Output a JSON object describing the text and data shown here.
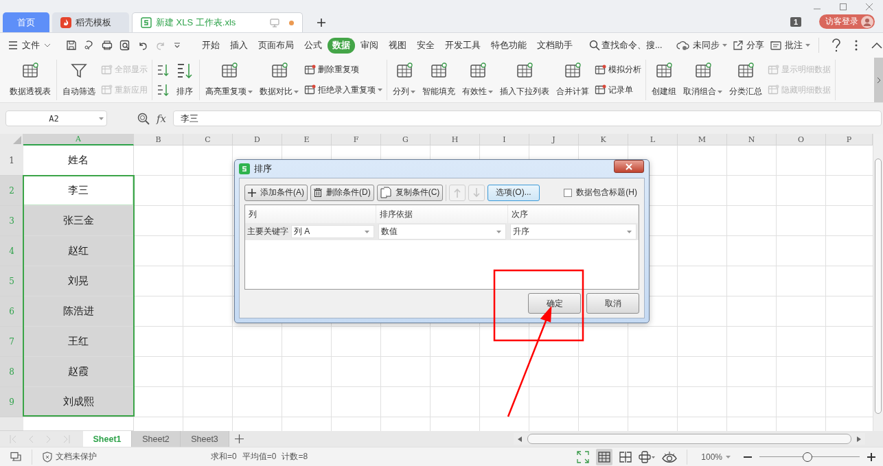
{
  "window": {
    "tabs": [
      {
        "label": "首页",
        "kind": "home",
        "selected": false
      },
      {
        "label": "稻壳模板",
        "kind": "docer",
        "selected": false
      },
      {
        "label": "新建 XLS 工作表.xls",
        "kind": "sheet",
        "selected": true
      }
    ],
    "badge": "1",
    "login": "访客登录"
  },
  "menu": {
    "file": "文件",
    "tabs": [
      {
        "label": "开始",
        "selected": false
      },
      {
        "label": "插入",
        "selected": false
      },
      {
        "label": "页面布局",
        "selected": false
      },
      {
        "label": "公式",
        "selected": false
      },
      {
        "label": "数据",
        "selected": true
      },
      {
        "label": "审阅",
        "selected": false
      },
      {
        "label": "视图",
        "selected": false
      },
      {
        "label": "安全",
        "selected": false
      },
      {
        "label": "开发工具",
        "selected": false
      },
      {
        "label": "特色功能",
        "selected": false
      },
      {
        "label": "文档助手",
        "selected": false
      }
    ],
    "search": "查找命令、搜...",
    "actions": [
      {
        "label": "未同步",
        "dropdown": true
      },
      {
        "label": "分享",
        "dropdown": false
      },
      {
        "label": "批注",
        "dropdown": true
      }
    ]
  },
  "ribbon": {
    "groups": [
      {
        "items": [
          {
            "kind": "large",
            "label": "数据透视表",
            "dropdown": false
          }
        ]
      },
      {
        "items": [
          {
            "kind": "large",
            "label": "自动筛选",
            "dropdown": false
          },
          {
            "kind": "column",
            "items": [
              {
                "label": "全部显示",
                "disabled": true,
                "dropdown": false
              },
              {
                "label": "重新应用",
                "disabled": true,
                "dropdown": false
              }
            ]
          }
        ]
      },
      {
        "items": [
          {
            "kind": "sort_icons"
          },
          {
            "kind": "large",
            "label": "排序",
            "dropdown": false
          }
        ]
      },
      {
        "items": [
          {
            "kind": "large",
            "label": "高亮重复项",
            "dropdown": true
          },
          {
            "kind": "large",
            "label": "数据对比",
            "dropdown": true
          },
          {
            "kind": "column",
            "items": [
              {
                "label": "删除重复项",
                "disabled": false,
                "dropdown": false
              },
              {
                "label": "拒绝录入重复项",
                "disabled": false,
                "dropdown": true
              }
            ]
          }
        ]
      },
      {
        "items": [
          {
            "kind": "large",
            "label": "分列",
            "dropdown": true
          },
          {
            "kind": "large",
            "label": "智能填充",
            "dropdown": false
          },
          {
            "kind": "large",
            "label": "有效性",
            "dropdown": true
          },
          {
            "kind": "large",
            "label": "插入下拉列表",
            "dropdown": false
          },
          {
            "kind": "large",
            "label": "合并计算",
            "dropdown": false
          },
          {
            "kind": "column",
            "items": [
              {
                "label": "模拟分析",
                "disabled": false,
                "dropdown": false
              },
              {
                "label": "记录单",
                "disabled": false,
                "dropdown": false
              }
            ]
          }
        ]
      },
      {
        "items": [
          {
            "kind": "large",
            "label": "创建组",
            "dropdown": false
          },
          {
            "kind": "large",
            "label": "取消组合",
            "dropdown": true
          },
          {
            "kind": "large",
            "label": "分类汇总",
            "dropdown": false
          },
          {
            "kind": "column",
            "items": [
              {
                "label": "显示明细数据",
                "disabled": true,
                "dropdown": false
              },
              {
                "label": "隐藏明细数据",
                "disabled": true,
                "dropdown": false
              }
            ]
          }
        ]
      }
    ]
  },
  "formula_bar": {
    "cell": "A2",
    "fx": "fx",
    "value": "李三"
  },
  "grid": {
    "columns": [
      {
        "label": "A",
        "selected": true
      },
      {
        "label": "B",
        "selected": false
      },
      {
        "label": "C",
        "selected": false
      },
      {
        "label": "D",
        "selected": false
      },
      {
        "label": "E",
        "selected": false
      },
      {
        "label": "F",
        "selected": false
      },
      {
        "label": "G",
        "selected": false
      },
      {
        "label": "H",
        "selected": false
      },
      {
        "label": "I",
        "selected": false
      },
      {
        "label": "J",
        "selected": false
      },
      {
        "label": "K",
        "selected": false
      },
      {
        "label": "L",
        "selected": false
      },
      {
        "label": "M",
        "selected": false
      },
      {
        "label": "N",
        "selected": false
      },
      {
        "label": "O",
        "selected": false
      },
      {
        "label": "P",
        "selected": false
      }
    ],
    "rows": [
      {
        "number": "1",
        "value": "姓名",
        "selected": false,
        "active": false
      },
      {
        "number": "2",
        "value": "李三",
        "selected": true,
        "active": true
      },
      {
        "number": "3",
        "value": "张三金",
        "selected": true,
        "active": false
      },
      {
        "number": "4",
        "value": "赵红",
        "selected": true,
        "active": false
      },
      {
        "number": "5",
        "value": "刘晃",
        "selected": true,
        "active": false
      },
      {
        "number": "6",
        "value": "陈浩进",
        "selected": true,
        "active": false
      },
      {
        "number": "7",
        "value": "王红",
        "selected": true,
        "active": false
      },
      {
        "number": "8",
        "value": "赵霞",
        "selected": true,
        "active": false
      },
      {
        "number": "9",
        "value": "刘成熙",
        "selected": true,
        "active": false
      }
    ]
  },
  "sheets": [
    {
      "label": "Sheet1",
      "selected": true
    },
    {
      "label": "Sheet2",
      "selected": false
    },
    {
      "label": "Sheet3",
      "selected": false
    }
  ],
  "status_bar": {
    "protection": "文档未保护",
    "stats": [
      "求和=0",
      "平均值=0",
      "计数=8"
    ],
    "zoom": "100%",
    "zoom_level": {
      "level": 0.48
    }
  },
  "dialog": {
    "title": "排序",
    "toolbar": [
      {
        "label": "添加条件(A)"
      },
      {
        "label": "删除条件(D)"
      },
      {
        "label": "复制条件(C)"
      }
    ],
    "move_buttons": [
      {
        "disabled": true
      },
      {
        "disabled": true
      }
    ],
    "options": {
      "label": "选项(O)...",
      "focused": true
    },
    "include_header": {
      "label": "数据包含标题(H)",
      "checked": false
    },
    "columns": [
      "列",
      "排序依据",
      "次序"
    ],
    "rows": [
      {
        "key": "主要关键字",
        "column": "列 A",
        "basis": "数值",
        "order": "升序"
      }
    ],
    "buttons": [
      "确定",
      "取消"
    ]
  }
}
